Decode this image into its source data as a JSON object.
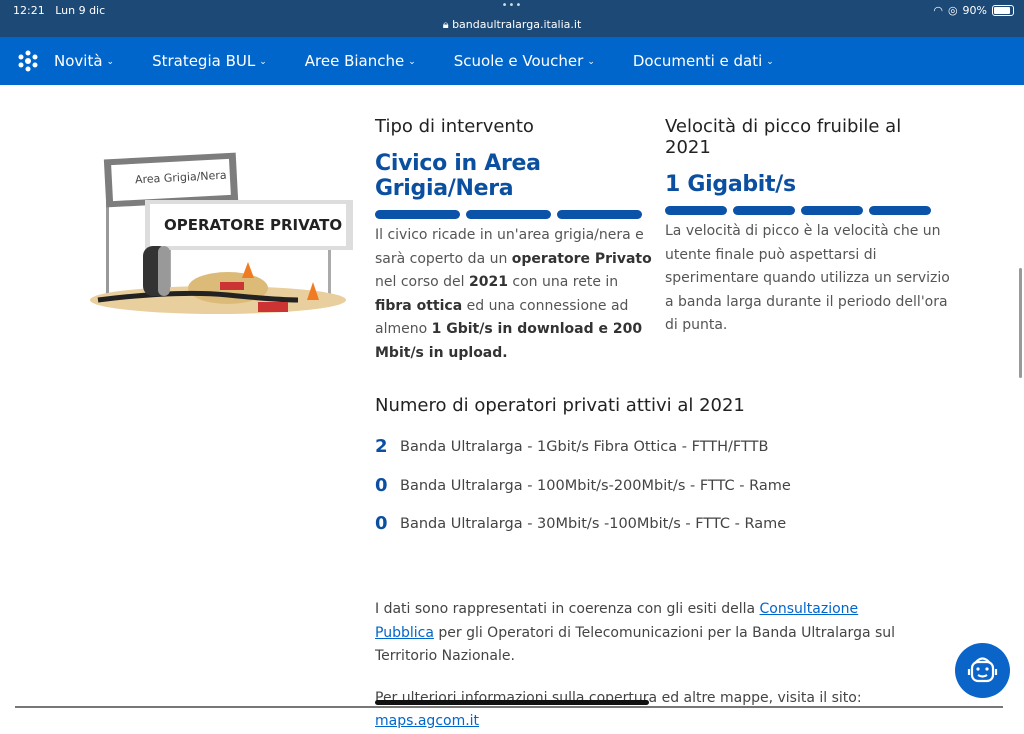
{
  "status": {
    "time": "12:21",
    "date": "Lun 9 dic",
    "url": "bandaultralarga.italia.it",
    "battery": "90%",
    "battery_level": 0.9
  },
  "nav": {
    "items": [
      "Novità",
      "Strategia BUL",
      "Aree Bianche",
      "Scuole e Voucher",
      "Documenti e dati"
    ]
  },
  "illustration": {
    "sign_small": "Area Grigia/Nera",
    "sign_big": "OPERATORE PRIVATO"
  },
  "intervento": {
    "title": "Tipo di intervento",
    "value": "Civico in Area Grigia/Nera",
    "p1": "Il civico ricade in un'area grigia/nera e sarà coperto da un ",
    "b1": "operatore Privato",
    "p2": " nel corso del ",
    "b2": "2021",
    "p3": " con una rete in ",
    "b3": "fibra ottica",
    "p4": " ed una connessione ad almeno ",
    "b4": "1 Gbit/s in download e 200 Mbit/s in upload."
  },
  "velocita": {
    "title": "Velocità di picco fruibile al 2021",
    "value": "1 Gigabit/s",
    "text": "La velocità di picco è la velocità che un utente finale può aspettarsi di sperimentare quando utilizza un servizio a banda larga durante il periodo dell'ora di punta."
  },
  "operatori": {
    "title": "Numero di operatori privati attivi al 2021",
    "rows": [
      {
        "n": "2",
        "label": "Banda Ultralarga - 1Gbit/s Fibra Ottica - FTTH/FTTB"
      },
      {
        "n": "0",
        "label": "Banda Ultralarga - 100Mbit/s-200Mbit/s - FTTC - Rame"
      },
      {
        "n": "0",
        "label": "Banda Ultralarga - 30Mbit/s -100Mbit/s - FTTC - Rame"
      }
    ]
  },
  "footer": {
    "t1": "I dati sono rappresentati in coerenza con gli esiti della ",
    "link1": "Consultazione Pubblica",
    "t2": " per gli Operatori di Telecomunicazioni per la Banda Ultralarga sul Territorio Nazionale.",
    "t3": "Per ulteriori informazioni sulla copertura ed altre mappe, visita il sito: ",
    "link2": "maps.agcom.it"
  }
}
